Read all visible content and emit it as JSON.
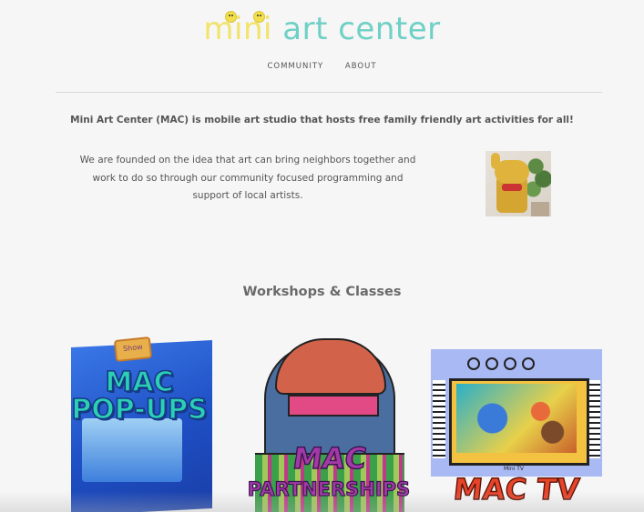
{
  "header": {
    "logo": {
      "word1": "mini",
      "word2": "art",
      "word3": "center"
    },
    "nav": [
      "COMMUNITY",
      "ABOUT"
    ]
  },
  "intro": {
    "tagline": "Mini Art Center (MAC) is mobile art studio that hosts free family friendly art activities for all!",
    "about": "We are founded on the idea that art can bring neighbors together and work to do so through our community focused programming and support of local artists."
  },
  "workshops": {
    "title": "Workshops & Classes",
    "cards": [
      {
        "label_line1": "MAC",
        "label_line2": "POP-UPS",
        "sign": "Show"
      },
      {
        "label_line1": "MAC",
        "label_line2": "PARTNERSHIPS"
      },
      {
        "label_line1": "MAC TV",
        "screen_text": "Mini TV"
      }
    ]
  },
  "colors": {
    "background": "#f6f6f6",
    "logo_yellow": "#f2e36a",
    "logo_teal": "#6fd0c6",
    "text": "#555555"
  }
}
